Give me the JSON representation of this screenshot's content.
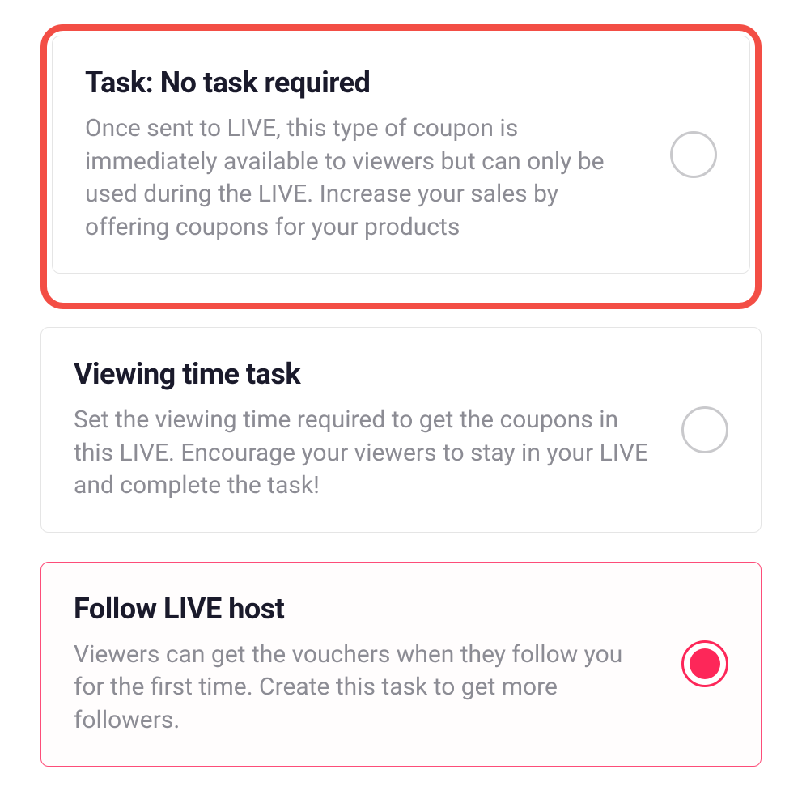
{
  "options": [
    {
      "title": "Task: No task required",
      "desc": "Once sent to LIVE, this type of coupon is immediately available to viewers but can only be used during the LIVE. Increase your sales by offering coupons for your products",
      "selected": false,
      "highlighted": true
    },
    {
      "title": "Viewing time task",
      "desc": "Set the viewing time required to get the coupons in this LIVE. Encourage your viewers to stay in your LIVE and complete the task!",
      "selected": false,
      "highlighted": false
    },
    {
      "title": "Follow LIVE host",
      "desc": "Viewers can get the vouchers when they follow you for the first time. Create this task to get more followers.",
      "selected": true,
      "highlighted": false
    }
  ]
}
